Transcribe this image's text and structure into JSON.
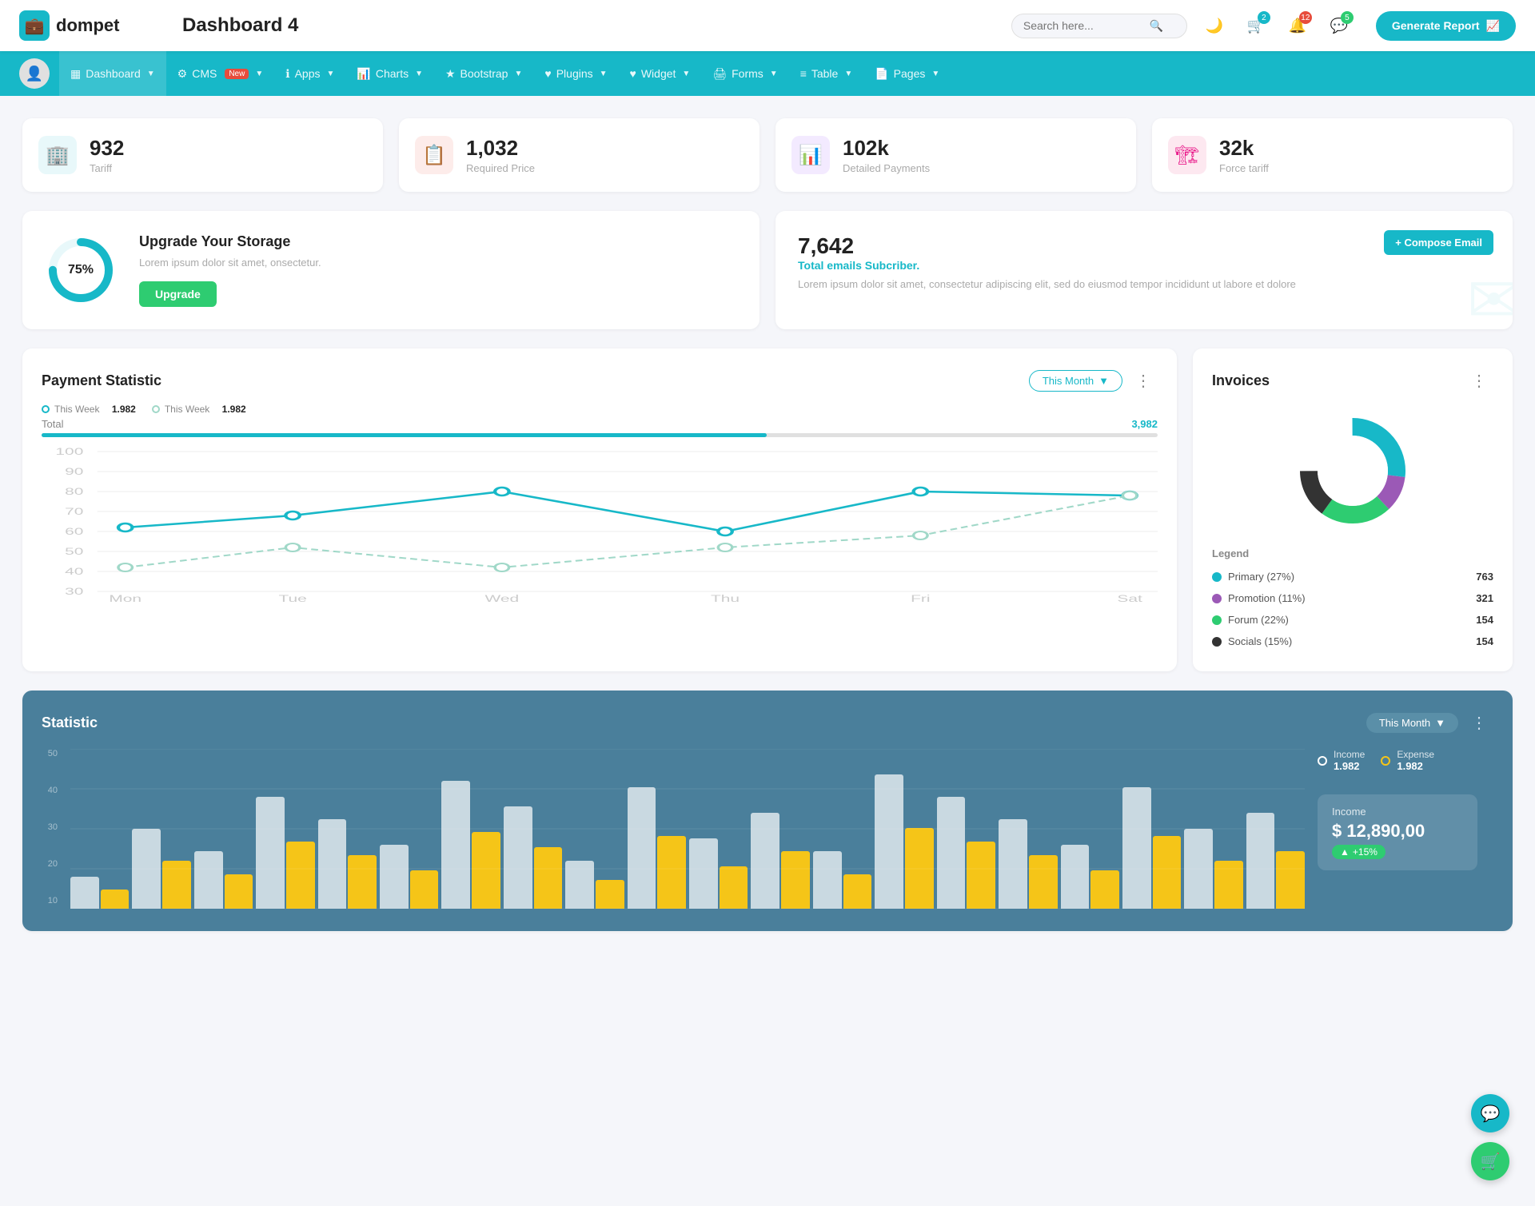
{
  "header": {
    "logo_icon": "💼",
    "logo_text": "dompet",
    "page_title": "Dashboard 4",
    "search_placeholder": "Search here...",
    "generate_btn": "Generate Report",
    "badge_cart": "2",
    "badge_bell": "12",
    "badge_chat": "5"
  },
  "nav": {
    "items": [
      {
        "label": "Dashboard",
        "icon": "▦",
        "active": true,
        "has_arrow": true
      },
      {
        "label": "CMS",
        "icon": "⚙",
        "has_arrow": true,
        "badge_new": "New"
      },
      {
        "label": "Apps",
        "icon": "ℹ",
        "has_arrow": true
      },
      {
        "label": "Charts",
        "icon": "📊",
        "has_arrow": true
      },
      {
        "label": "Bootstrap",
        "icon": "★",
        "has_arrow": true
      },
      {
        "label": "Plugins",
        "icon": "♥",
        "has_arrow": true
      },
      {
        "label": "Widget",
        "icon": "♥",
        "has_arrow": true
      },
      {
        "label": "Forms",
        "icon": "🖨",
        "has_arrow": true
      },
      {
        "label": "Table",
        "icon": "≡",
        "has_arrow": true
      },
      {
        "label": "Pages",
        "icon": "📄",
        "has_arrow": true
      }
    ]
  },
  "stat_cards": [
    {
      "value": "932",
      "label": "Tariff",
      "icon_type": "teal",
      "icon": "🏢"
    },
    {
      "value": "1,032",
      "label": "Required Price",
      "icon_type": "red",
      "icon": "📋"
    },
    {
      "value": "102k",
      "label": "Detailed Payments",
      "icon_type": "purple",
      "icon": "📊"
    },
    {
      "value": "32k",
      "label": "Force tariff",
      "icon_type": "pink",
      "icon": "🏗"
    }
  ],
  "storage": {
    "percent": "75%",
    "title": "Upgrade Your Storage",
    "desc": "Lorem ipsum dolor sit amet, onsectetur.",
    "btn_label": "Upgrade",
    "donut_percent": 75
  },
  "email": {
    "count": "7,642",
    "subtitle": "Total emails Subcriber.",
    "desc": "Lorem ipsum dolor sit amet, consectetur adipiscing elit, sed do eiusmod tempor incididunt ut labore et dolore",
    "compose_btn": "+ Compose Email"
  },
  "payment": {
    "title": "Payment Statistic",
    "filter_label": "This Month",
    "legend1_label": "This Week",
    "legend1_value": "1.982",
    "legend2_label": "This Week",
    "legend2_value": "1.982",
    "total_label": "Total",
    "total_value": "3,982",
    "progress_pct": 65,
    "x_labels": [
      "Mon",
      "Tue",
      "Wed",
      "Thu",
      "Fri",
      "Sat"
    ],
    "y_labels": [
      "100",
      "90",
      "80",
      "70",
      "60",
      "50",
      "40",
      "30"
    ],
    "line1_points": "40,160 180,140 330,125 490,130 640,95 780,100",
    "line2_points": "40,150 180,135 330,80 490,130 640,110 780,95"
  },
  "invoices": {
    "title": "Invoices",
    "donut": {
      "segments": [
        {
          "label": "Primary",
          "pct": 27,
          "color": "#17b8c8",
          "count": "763"
        },
        {
          "label": "Promotion",
          "pct": 11,
          "color": "#9b59b6",
          "count": "321"
        },
        {
          "label": "Forum",
          "pct": 22,
          "color": "#2ecc71",
          "count": "154"
        },
        {
          "label": "Socials",
          "pct": 15,
          "color": "#333",
          "count": "154"
        }
      ]
    },
    "legend_label": "Legend"
  },
  "statistic": {
    "title": "Statistic",
    "filter_label": "This Month",
    "bars": [
      10,
      25,
      18,
      35,
      28,
      20,
      40,
      32,
      15,
      38,
      22,
      30,
      18,
      42,
      35,
      28,
      20,
      38,
      25,
      30
    ],
    "income_label": "Income",
    "income_value": "1.982",
    "expense_label": "Expense",
    "expense_value": "1.982",
    "income_panel_label": "Income",
    "income_amount": "$ 12,890,00",
    "income_change": "+15%",
    "month_label": "Month"
  }
}
